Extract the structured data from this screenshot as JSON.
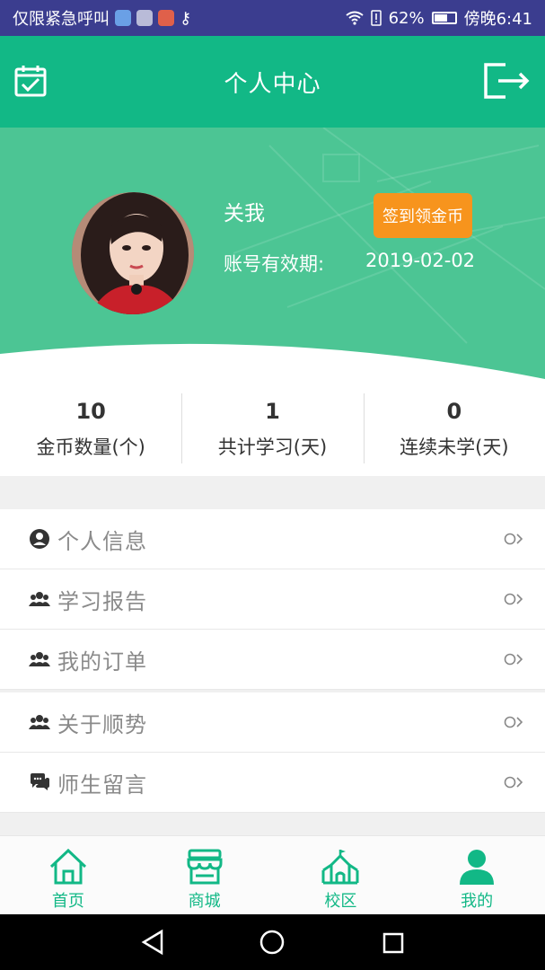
{
  "status_bar": {
    "carrier": "仅限紧急呼叫",
    "battery": "62%",
    "time": "傍晚6:41"
  },
  "header": {
    "title": "个人中心",
    "left_icon": "calendar-check-icon",
    "right_icon": "logout-icon"
  },
  "profile": {
    "name": "关我",
    "expiry_label": "账号有效期:",
    "expiry_value": "2019-02-02",
    "sign_button": "签到领金币"
  },
  "stats": [
    {
      "value": "10",
      "label": "金币数量(个)"
    },
    {
      "value": "1",
      "label": "共计学习(天)"
    },
    {
      "value": "0",
      "label": "连续未学(天)"
    }
  ],
  "menu": [
    {
      "label": "个人信息",
      "icon": "user-circle-icon"
    },
    {
      "label": "学习报告",
      "icon": "users-icon"
    },
    {
      "label": "我的订单",
      "icon": "users-icon"
    },
    {
      "label": "关于顺势",
      "icon": "users-icon"
    },
    {
      "label": "师生留言",
      "icon": "chat-icon"
    }
  ],
  "bottom_nav": [
    {
      "label": "首页",
      "icon": "home-icon"
    },
    {
      "label": "商城",
      "icon": "store-icon"
    },
    {
      "label": "校区",
      "icon": "school-icon"
    },
    {
      "label": "我的",
      "icon": "user-icon"
    }
  ],
  "colors": {
    "primary": "#12b886",
    "banner": "#4cc594",
    "accent_button": "#f7941d",
    "status_bar": "#3b3d8f"
  }
}
